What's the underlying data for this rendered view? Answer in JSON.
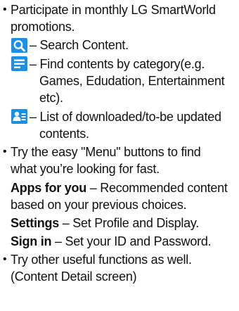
{
  "bullets": [
    {
      "lines": [
        "Participate in monthly LG SmartWorld",
        "promotions."
      ]
    },
    {
      "lines": [
        "Try the easy \"Menu\" buttons to find",
        "what you’re looking for fast."
      ]
    },
    {
      "lines": [
        "Try other useful functions as well.",
        "(Content Detail screen)"
      ]
    }
  ],
  "icon_items": [
    {
      "icon": "search-icon",
      "lines": [
        "– Search Content."
      ]
    },
    {
      "icon": "category-list-icon",
      "lines": [
        "– Find contents by category(e.g.",
        "Games, Edudation, Entertainment",
        "etc)."
      ]
    },
    {
      "icon": "downloads-icon",
      "lines": [
        "– List of downloaded/to-be updated",
        "contents."
      ]
    }
  ],
  "menu_items": [
    {
      "term": "Apps for you",
      "desc": " – Recommended content",
      "cont": "based on your previous choices."
    },
    {
      "term": "Settings",
      "desc": " – Set Profile and Display."
    },
    {
      "term": "Sign in",
      "desc": " – Set your ID and Password."
    }
  ],
  "colors": {
    "icon_blue": "#1a8fe6",
    "text": "#111111"
  }
}
